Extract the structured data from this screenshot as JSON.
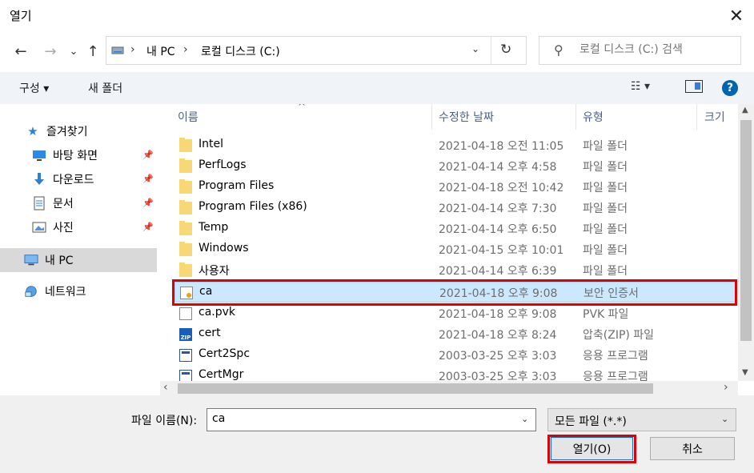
{
  "window": {
    "title": "열기",
    "close_glyph": "✕"
  },
  "nav": {
    "back_glyph": "←",
    "forward_glyph": "→",
    "recent_glyph": "⌄",
    "up_glyph": "↑",
    "crumb_sep": "›",
    "crumbs": [
      "내 PC",
      "로컬 디스크 (C:)"
    ],
    "dropdown_glyph": "⌄",
    "refresh_glyph": "↻",
    "search_glyph": "⚲",
    "search_placeholder": "로컬 디스크 (C:) 검색"
  },
  "toolbar": {
    "organize_label": "구성 ▾",
    "new_folder_label": "새 폴더",
    "view_label": "☷ ▾",
    "help_label": "?"
  },
  "sidebar": {
    "quick_access": "즐겨찾기",
    "items": [
      {
        "label": "바탕 화면",
        "icon": "desktop-icon"
      },
      {
        "label": "다운로드",
        "icon": "download-icon"
      },
      {
        "label": "문서",
        "icon": "documents-icon"
      },
      {
        "label": "사진",
        "icon": "pictures-icon"
      }
    ],
    "pin_glyph": "📌",
    "this_pc": "내 PC",
    "network": "네트워크"
  },
  "list": {
    "sort_glyph": "^",
    "columns": [
      "이름",
      "수정한 날짜",
      "유형",
      "크기"
    ],
    "rows": [
      {
        "name": "Intel",
        "date": "2021-04-18 오전 11:05",
        "type": "파일 폴더",
        "icon": "folder"
      },
      {
        "name": "PerfLogs",
        "date": "2021-04-14 오후 4:58",
        "type": "파일 폴더",
        "icon": "folder"
      },
      {
        "name": "Program Files",
        "date": "2021-04-18 오전 10:42",
        "type": "파일 폴더",
        "icon": "folder"
      },
      {
        "name": "Program Files (x86)",
        "date": "2021-04-14 오후 7:30",
        "type": "파일 폴더",
        "icon": "folder"
      },
      {
        "name": "Temp",
        "date": "2021-04-14 오후 6:50",
        "type": "파일 폴더",
        "icon": "folder"
      },
      {
        "name": "Windows",
        "date": "2021-04-15 오후 10:01",
        "type": "파일 폴더",
        "icon": "folder"
      },
      {
        "name": "사용자",
        "date": "2021-04-14 오후 6:39",
        "type": "파일 폴더",
        "icon": "folder"
      },
      {
        "name": "ca",
        "date": "2021-04-18 오후 9:08",
        "type": "보안 인증서",
        "icon": "certificate"
      },
      {
        "name": "ca.pvk",
        "date": "2021-04-18 오후 9:08",
        "type": "PVK 파일",
        "icon": "file"
      },
      {
        "name": "cert",
        "date": "2021-04-18 오후 8:24",
        "type": "압축(ZIP) 파일",
        "icon": "zip"
      },
      {
        "name": "Cert2Spc",
        "date": "2003-03-25 오후 3:03",
        "type": "응용 프로그램",
        "icon": "app"
      },
      {
        "name": "CertMgr",
        "date": "2003-03-25 오후 3:03",
        "type": "응용 프로그램",
        "icon": "app"
      }
    ],
    "zip_badge": "ZIP"
  },
  "scroll": {
    "up": "▲",
    "down": "▼",
    "left": "‹",
    "right": "›"
  },
  "bottom": {
    "filename_label": "파일 이름(N):",
    "filename_value": "ca",
    "dropdown_glyph": "⌄",
    "filter_value": "모든 파일 (*.*)",
    "open_label": "열기(O)",
    "cancel_label": "취소"
  },
  "colors": {
    "selection": "#cce8ff",
    "highlight": "#e00000",
    "accent": "#0078d7"
  }
}
